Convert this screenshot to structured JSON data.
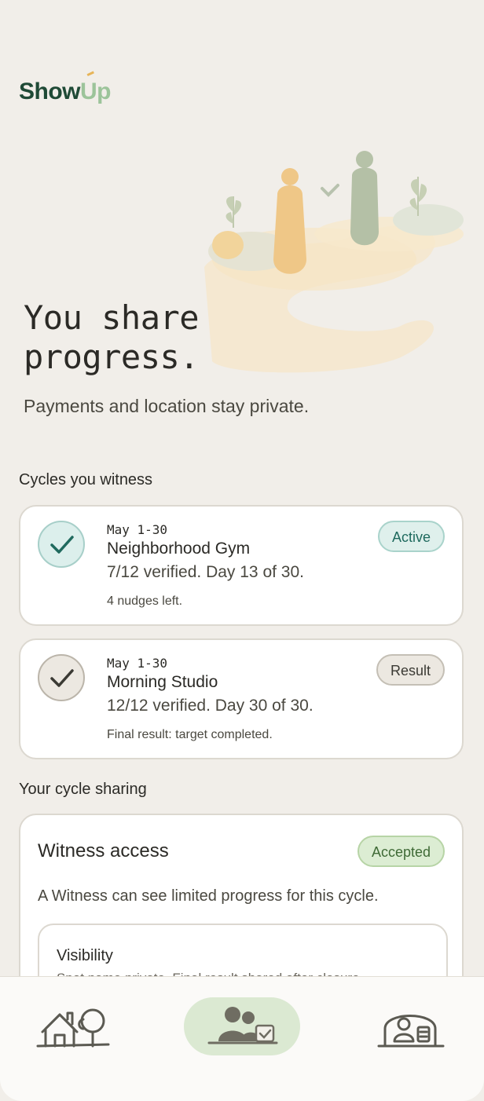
{
  "app": {
    "logo_show": "Show",
    "logo_up": "Up"
  },
  "hero": {
    "title_line1": "You share",
    "title_line2": "progress.",
    "subtitle": "Payments and location stay private."
  },
  "witness_section": {
    "label": "Cycles you witness",
    "cycles": [
      {
        "date": "May 1-30",
        "name": "Neighborhood Gym",
        "progress": "7/12 verified. Day 13 of 30.",
        "note": "4 nudges left.",
        "badge": "Active"
      },
      {
        "date": "May 1-30",
        "name": "Morning Studio",
        "progress": "12/12 verified. Day 30 of 30.",
        "note": "Final result: target completed.",
        "badge": "Result"
      }
    ]
  },
  "sharing_section": {
    "label": "Your cycle sharing",
    "access_title": "Witness access",
    "access_badge": "Accepted",
    "access_desc": "A Witness can see limited progress for this cycle.",
    "visibility_title": "Visibility",
    "visibility_desc": "Spot name private. Final result shared after closure."
  },
  "nav": {
    "items": [
      {
        "icon": "home-icon",
        "active": false
      },
      {
        "icon": "witness-people-icon",
        "active": true
      },
      {
        "icon": "profile-icon",
        "active": false
      }
    ]
  },
  "colors": {
    "background": "#f1eee9",
    "brand_dark": "#1f4a36",
    "brand_light": "#9cc49a",
    "active_teal": "#1f6a5e",
    "accepted_green": "#3f6a36",
    "nav_active": "#dbe9d2"
  }
}
